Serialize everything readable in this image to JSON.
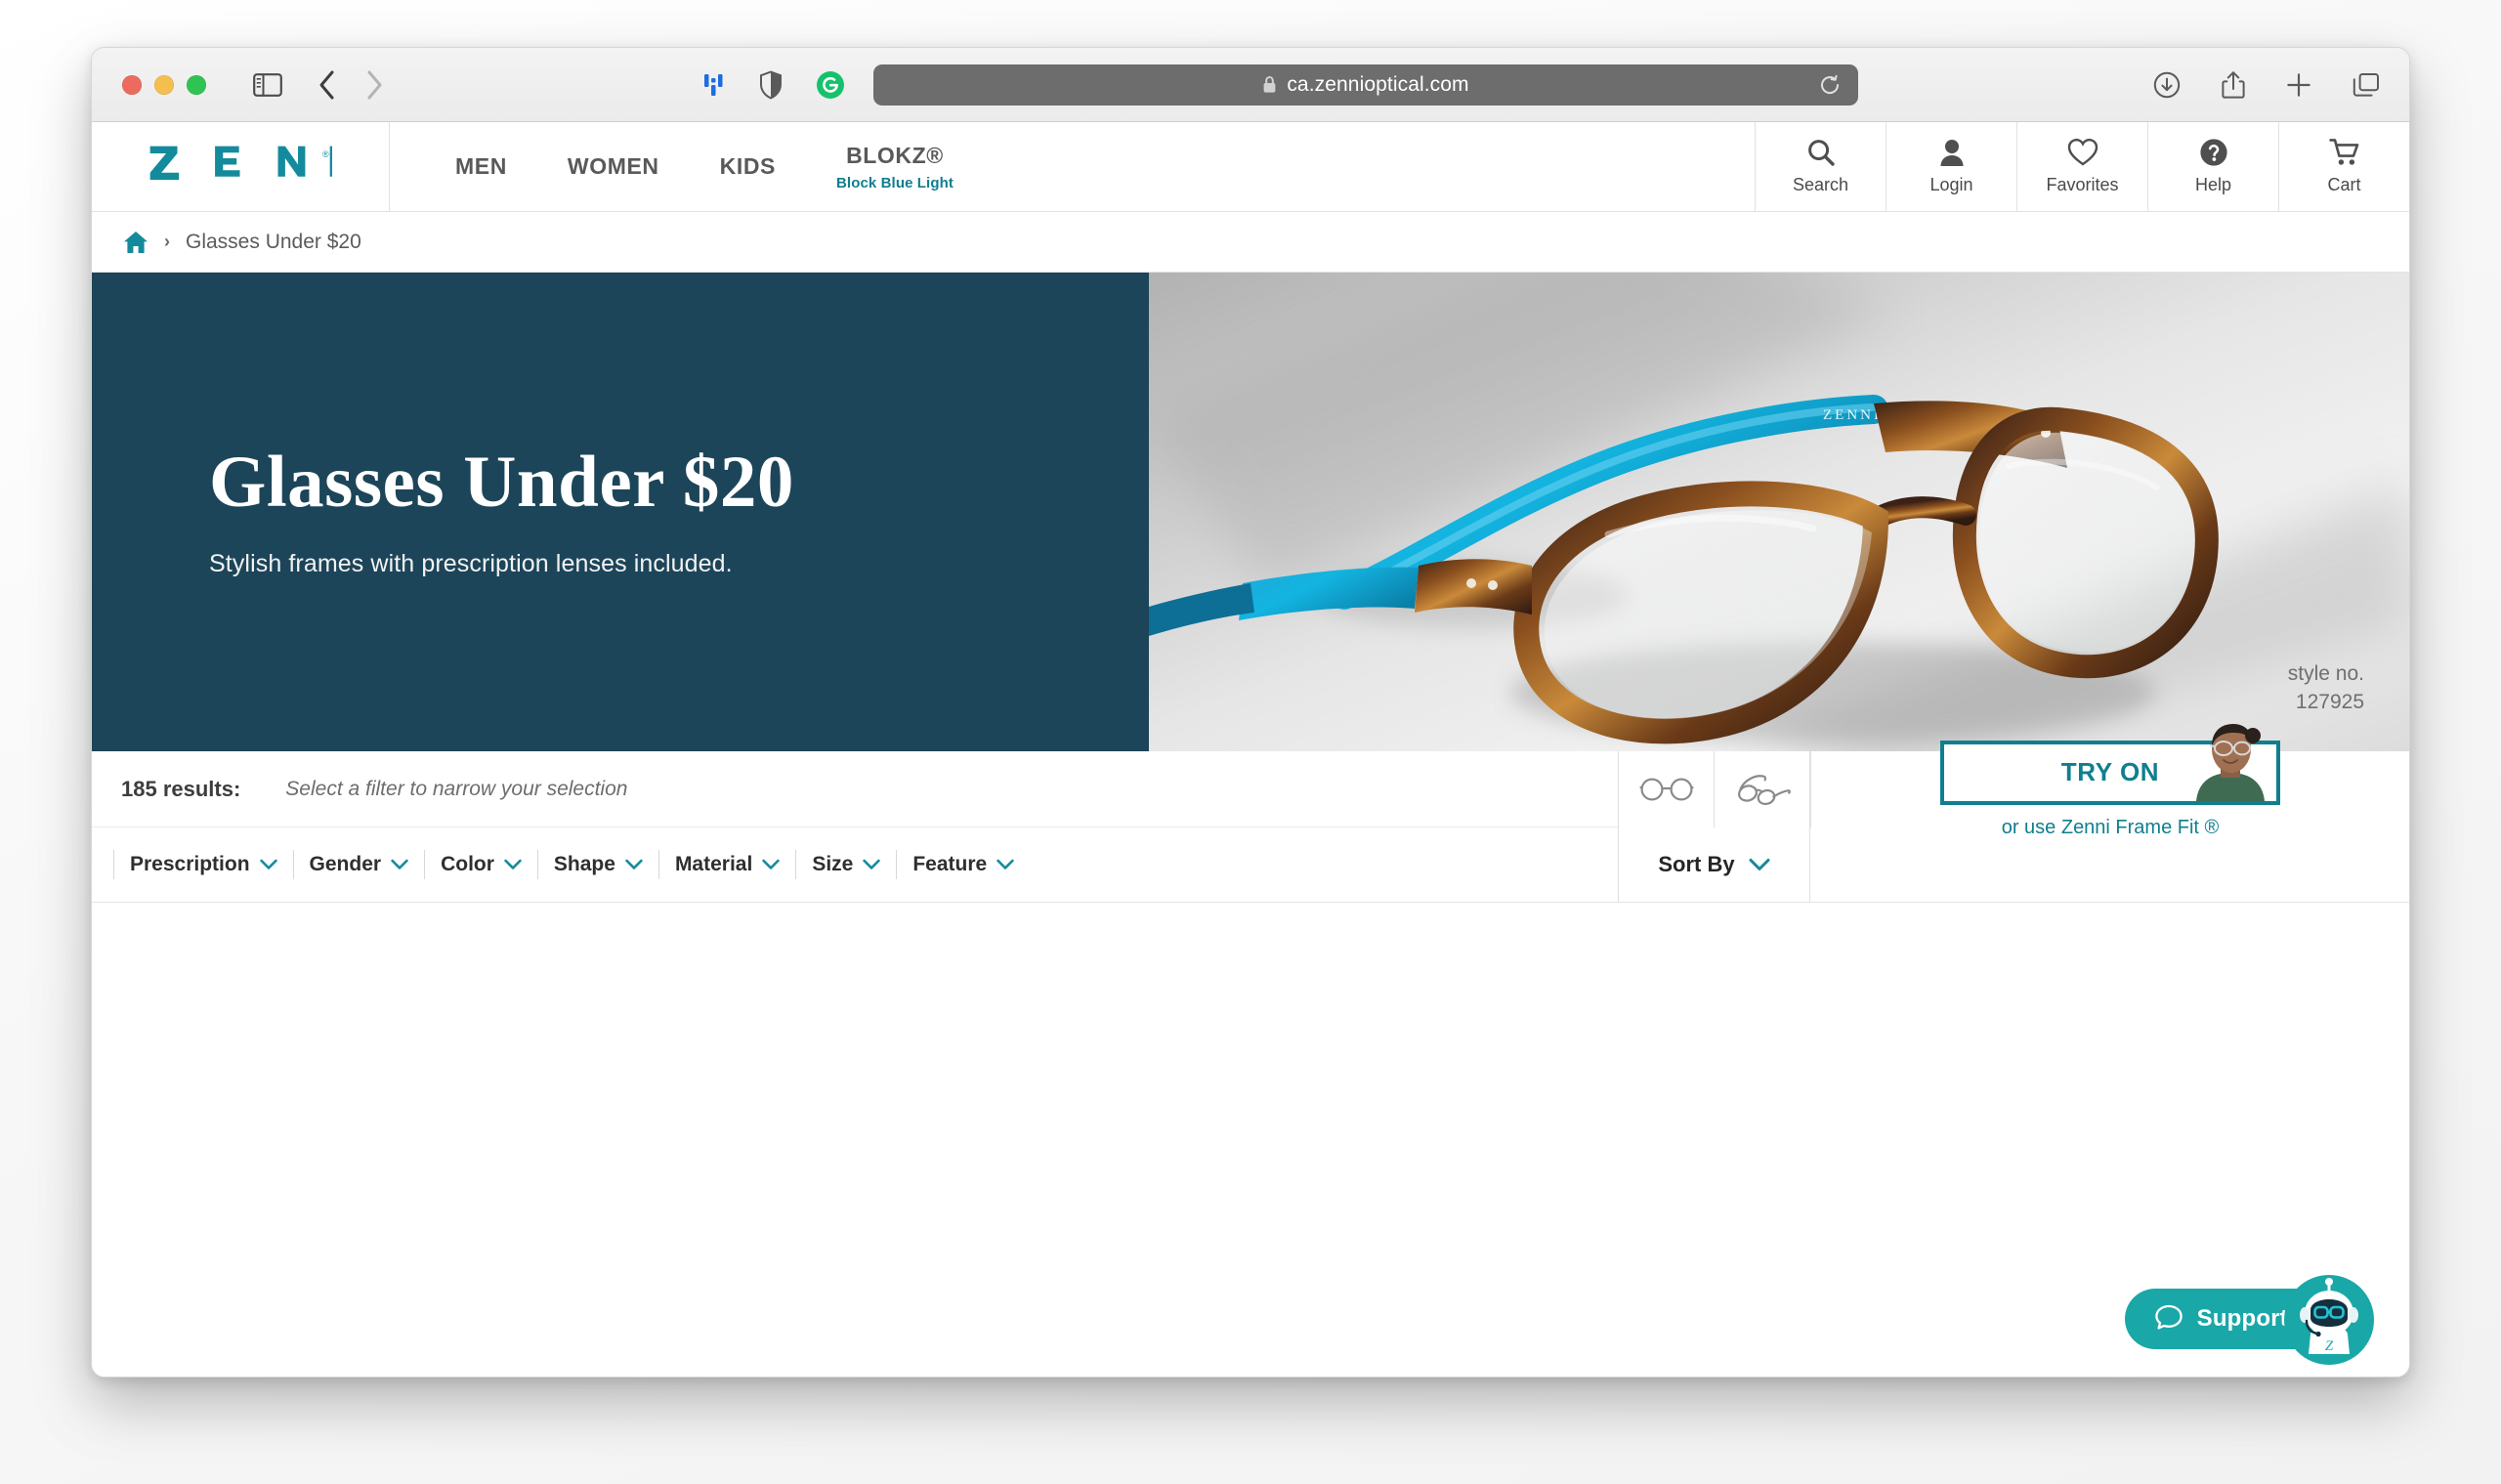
{
  "browser": {
    "url": "ca.zennioptical.com",
    "lock_icon": "lock-icon",
    "reload_icon": "reload-icon",
    "traffic_lights": [
      "close-button",
      "minimize-button",
      "zoom-button"
    ],
    "sidebar_icon": "sidebar-toggle-icon",
    "back_icon": "back-arrow-icon",
    "forward_icon": "forward-arrow-icon",
    "extensions": [
      "dashlane-extension-icon",
      "shield-privacy-extension-icon",
      "grammarly-extension-icon"
    ],
    "right_icons": [
      "downloads-icon",
      "share-icon",
      "new-tab-icon",
      "tab-overview-icon"
    ]
  },
  "site": {
    "logo_text": "ZENNI",
    "logo_trademark": "®",
    "nav": [
      {
        "label": "MEN",
        "sub": ""
      },
      {
        "label": "WOMEN",
        "sub": ""
      },
      {
        "label": "KIDS",
        "sub": ""
      },
      {
        "label": "BLOKZ®",
        "sub": "Block Blue Light"
      }
    ],
    "actions": [
      {
        "label": "Search",
        "icon": "search-icon"
      },
      {
        "label": "Login",
        "icon": "user-icon"
      },
      {
        "label": "Favorites",
        "icon": "heart-icon"
      },
      {
        "label": "Help",
        "icon": "question-circle-icon"
      },
      {
        "label": "Cart",
        "icon": "shopping-cart-icon"
      }
    ]
  },
  "breadcrumb": {
    "home_icon": "home-icon",
    "separator": "›",
    "current": "Glasses Under $20"
  },
  "hero": {
    "title": "Glasses Under $20",
    "subtitle": "Stylish frames with prescription lenses included.",
    "style_label": "style no.",
    "style_number": "127925",
    "bg_color": "#1c4559"
  },
  "results": {
    "count_label": "185 results:",
    "hint": "Select a filter to narrow your selection",
    "filters": [
      {
        "label": "Prescription"
      },
      {
        "label": "Gender"
      },
      {
        "label": "Color"
      },
      {
        "label": "Shape"
      },
      {
        "label": "Material"
      },
      {
        "label": "Size"
      },
      {
        "label": "Feature"
      }
    ],
    "view_toggles": [
      {
        "icon": "glasses-front-view-icon"
      },
      {
        "icon": "glasses-angled-view-icon"
      }
    ],
    "sort_by_label": "Sort By",
    "try_on_label": "TRY ON",
    "frame_fit_label": "or use Zenni Frame Fit ®"
  },
  "support": {
    "label": "Support",
    "chat_icon": "chat-bubble-icon",
    "bot_icon": "support-robot-avatar"
  },
  "colors": {
    "brand_teal": "#0f7f8f",
    "hero_navy": "#1c4559",
    "support_teal": "#1aa7a7"
  }
}
